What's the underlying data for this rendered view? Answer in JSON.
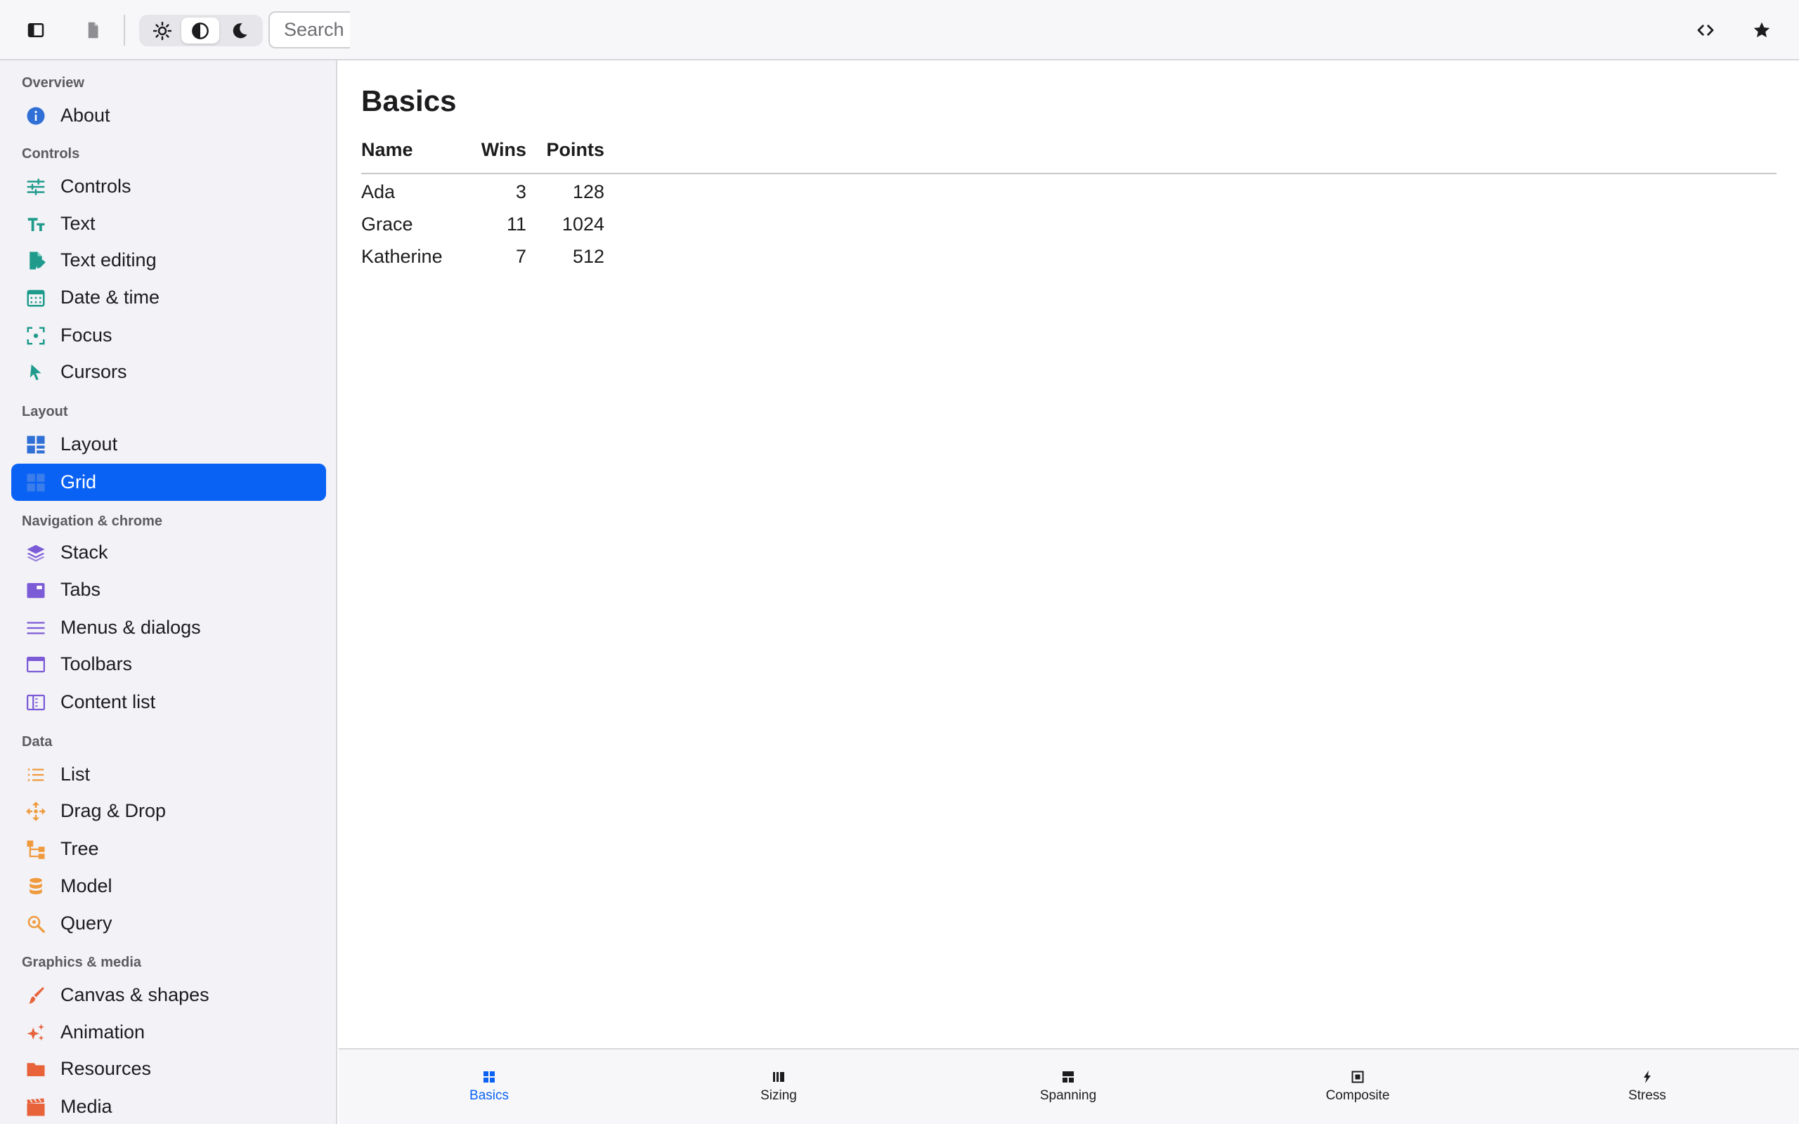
{
  "toolbar": {
    "search_placeholder": "Search",
    "icons": [
      "sidebar-toggle-icon",
      "document-icon",
      "sun-icon",
      "contrast-icon",
      "moon-icon",
      "code-icon",
      "star-icon"
    ],
    "theme_selected": "contrast"
  },
  "sidebar": {
    "sections": [
      {
        "title": "Overview",
        "items": [
          {
            "label": "About",
            "icon": "info-icon"
          }
        ]
      },
      {
        "title": "Controls",
        "items": [
          {
            "label": "Controls",
            "icon": "sliders-icon"
          },
          {
            "label": "Text",
            "icon": "text-size-icon"
          },
          {
            "label": "Text editing",
            "icon": "edit-document-icon"
          },
          {
            "label": "Date & time",
            "icon": "calendar-icon"
          },
          {
            "label": "Focus",
            "icon": "focus-icon"
          },
          {
            "label": "Cursors",
            "icon": "cursor-icon"
          }
        ]
      },
      {
        "title": "Layout",
        "items": [
          {
            "label": "Layout",
            "icon": "layout-icon"
          },
          {
            "label": "Grid",
            "icon": "grid-icon",
            "selected": true
          }
        ]
      },
      {
        "title": "Navigation & chrome",
        "items": [
          {
            "label": "Stack",
            "icon": "layers-icon"
          },
          {
            "label": "Tabs",
            "icon": "tabs-icon"
          },
          {
            "label": "Menus & dialogs",
            "icon": "menu-lines-icon"
          },
          {
            "label": "Toolbars",
            "icon": "window-icon"
          },
          {
            "label": "Content list",
            "icon": "columns-icon"
          }
        ]
      },
      {
        "title": "Data",
        "items": [
          {
            "label": "List",
            "icon": "list-icon"
          },
          {
            "label": "Drag & Drop",
            "icon": "move-arrows-icon"
          },
          {
            "label": "Tree",
            "icon": "tree-icon"
          },
          {
            "label": "Model",
            "icon": "database-icon"
          },
          {
            "label": "Query",
            "icon": "search-magnifier-icon"
          }
        ]
      },
      {
        "title": "Graphics & media",
        "items": [
          {
            "label": "Canvas & shapes",
            "icon": "brush-icon"
          },
          {
            "label": "Animation",
            "icon": "sparkles-icon"
          },
          {
            "label": "Resources",
            "icon": "folder-icon"
          },
          {
            "label": "Media",
            "icon": "film-icon"
          }
        ]
      }
    ]
  },
  "colors": {
    "accent": "#0a62f5",
    "overview": "#2f6fd6",
    "controls": "#1f9b8c",
    "layout": "#2f6fd6",
    "navigation": "#7b5bd6",
    "data": "#ef9a3c",
    "graphics": "#e8623a"
  },
  "main": {
    "title": "Basics",
    "table": {
      "headers": [
        "Name",
        "Wins",
        "Points"
      ],
      "rows": [
        [
          "Ada",
          "3",
          "128"
        ],
        [
          "Grace",
          "11",
          "1024"
        ],
        [
          "Katherine",
          "7",
          "512"
        ]
      ]
    }
  },
  "bottom_tabs": [
    {
      "label": "Basics",
      "icon": "grid-small-icon",
      "active": true
    },
    {
      "label": "Sizing",
      "icon": "bars-icon"
    },
    {
      "label": "Spanning",
      "icon": "spanning-icon"
    },
    {
      "label": "Composite",
      "icon": "composite-icon"
    },
    {
      "label": "Stress",
      "icon": "bolt-icon"
    }
  ]
}
